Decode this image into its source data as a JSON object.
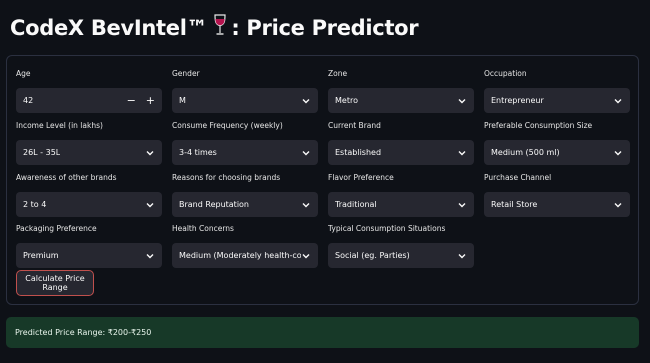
{
  "app": {
    "title_prefix": "CodeX BevIntel™",
    "title_suffix": ": Price Predictor"
  },
  "form": {
    "age": {
      "label": "Age",
      "value": "42"
    },
    "gender": {
      "label": "Gender",
      "value": "M"
    },
    "zone": {
      "label": "Zone",
      "value": "Metro"
    },
    "occupation": {
      "label": "Occupation",
      "value": "Entrepreneur"
    },
    "income": {
      "label": "Income Level (in lakhs)",
      "value": "26L - 35L"
    },
    "frequency": {
      "label": "Consume Frequency (weekly)",
      "value": "3-4 times"
    },
    "brand": {
      "label": "Current Brand",
      "value": "Established"
    },
    "size": {
      "label": "Preferable Consumption Size",
      "value": "Medium (500 ml)"
    },
    "awareness": {
      "label": "Awareness of other brands",
      "value": "2 to 4"
    },
    "reasons": {
      "label": "Reasons for choosing brands",
      "value": "Brand Reputation"
    },
    "flavor": {
      "label": "Flavor Preference",
      "value": "Traditional"
    },
    "channel": {
      "label": "Purchase Channel",
      "value": "Retail Store"
    },
    "packaging": {
      "label": "Packaging Preference",
      "value": "Premium"
    },
    "health": {
      "label": "Health Concerns",
      "value": "Medium (Moderately health-conscious)"
    },
    "situations": {
      "label": "Typical Consumption Situations",
      "value": "Social (eg. Parties)"
    },
    "minus_label": "−",
    "plus_label": "+",
    "button_label": "Calculate Price Range"
  },
  "result": {
    "text": "Predicted Price Range: ₹200-₹250"
  },
  "colors": {
    "background": "#0e1117",
    "input_bg": "#262730",
    "button_border": "#c0504d",
    "result_bg": "#173928"
  }
}
